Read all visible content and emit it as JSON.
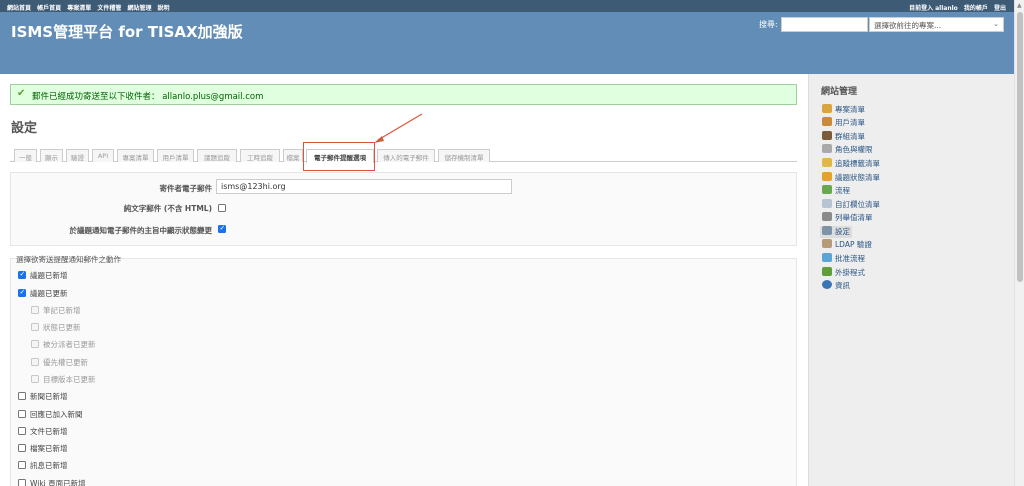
{
  "top_menu": {
    "left_items": [
      "網站首頁",
      "帳戶首頁",
      "專案清單",
      "文件稽管",
      "網站管理",
      "說明"
    ],
    "logged_in_prefix": "目前登入",
    "user": "allanlo",
    "my_account": "我的帳戶",
    "logout": "登出"
  },
  "header": {
    "title": "ISMS管理平台 for TISAX加強版",
    "search_label": "搜尋:",
    "search_value": "",
    "project_select": "選擇欲前往的專案..."
  },
  "flash": {
    "message": "郵件已經成功寄送至以下收件者： allanlo.plus@gmail.com"
  },
  "page": {
    "title": "設定"
  },
  "tabs": [
    {
      "label": "一般",
      "selected": false
    },
    {
      "label": "顯示",
      "selected": false
    },
    {
      "label": "驗證",
      "selected": false
    },
    {
      "label": "API",
      "selected": false
    },
    {
      "label": "專案清單",
      "selected": false
    },
    {
      "label": "用戶清單",
      "selected": false
    },
    {
      "label": "議題追蹤",
      "selected": false
    },
    {
      "label": "工時追蹤",
      "selected": false
    },
    {
      "label": "檔案",
      "selected": false
    },
    {
      "label": "電子郵件提醒選項",
      "selected": true
    },
    {
      "label": "傳入的電子郵件",
      "selected": false
    },
    {
      "label": "儲存機制清單",
      "selected": false
    }
  ],
  "settings": {
    "emission_label": "寄件者電子郵件",
    "emission_value": "isms@123hi.org",
    "plain_text_label": "純文字郵件 (不含 HTML)",
    "plain_text_checked": false,
    "show_status_label": "於議題通知電子郵件的主旨中顯示狀態變更",
    "show_status_checked": true
  },
  "notifications": {
    "legend": "選擇欲寄送提醒通知郵件之動作",
    "items": [
      {
        "label": "議題已新增",
        "checked": true,
        "disabled": false
      },
      {
        "label": "議題已更新",
        "checked": true,
        "disabled": false
      },
      {
        "label": "筆記已新增",
        "checked": false,
        "disabled": true
      },
      {
        "label": "狀態已更新",
        "checked": false,
        "disabled": true
      },
      {
        "label": "被分派者已更新",
        "checked": false,
        "disabled": true
      },
      {
        "label": "優先權已更新",
        "checked": false,
        "disabled": true
      },
      {
        "label": "目標版本已更新",
        "checked": false,
        "disabled": true
      },
      {
        "label": "新聞已新增",
        "checked": false,
        "disabled": false
      },
      {
        "label": "回應已加入新聞",
        "checked": false,
        "disabled": false
      },
      {
        "label": "文件已新增",
        "checked": false,
        "disabled": false
      },
      {
        "label": "檔案已新增",
        "checked": false,
        "disabled": false
      },
      {
        "label": "訊息已新增",
        "checked": false,
        "disabled": false
      },
      {
        "label": "Wiki 頁面已新增",
        "checked": false,
        "disabled": false
      }
    ]
  },
  "sidebar": {
    "title": "網站管理",
    "items": [
      {
        "label": "專案清單",
        "icon": "projects-icon",
        "color": "#d9a441"
      },
      {
        "label": "用戶清單",
        "icon": "user-icon",
        "color": "#c98a3b"
      },
      {
        "label": "群組清單",
        "icon": "group-icon",
        "color": "#7a5c3a"
      },
      {
        "label": "角色與權限",
        "icon": "key-icon",
        "color": "#a9a9a9"
      },
      {
        "label": "追蹤標籤清單",
        "icon": "tracker-icon",
        "color": "#e0b84a"
      },
      {
        "label": "議題狀態清單",
        "icon": "status-icon",
        "color": "#e3a12f"
      },
      {
        "label": "流程",
        "icon": "workflow-icon",
        "color": "#6aa84f"
      },
      {
        "label": "自訂欄位清單",
        "icon": "custom-field-icon",
        "color": "#b7c4d4"
      },
      {
        "label": "列舉值清單",
        "icon": "list-icon",
        "color": "#8a8a8a"
      },
      {
        "label": "設定",
        "icon": "settings-icon",
        "color": "#7f93a8",
        "selected": true
      },
      {
        "label": "LDAP 驗證",
        "icon": "ldap-icon",
        "color": "#b59b7a"
      },
      {
        "label": "批准流程",
        "icon": "approval-icon",
        "color": "#5aa5d6"
      },
      {
        "label": "外掛程式",
        "icon": "plugin-icon",
        "color": "#5f9e3a"
      },
      {
        "label": "資訊",
        "icon": "info-icon",
        "color": "#3b74b5"
      }
    ]
  },
  "colors": {
    "top_menu_bg": "#3e5b76",
    "header_bg": "#628db6",
    "flash_bg": "#dfffdf",
    "sidebar_bg": "#eeeeee",
    "link": "#2a5685",
    "annotation": "#d9583b"
  }
}
